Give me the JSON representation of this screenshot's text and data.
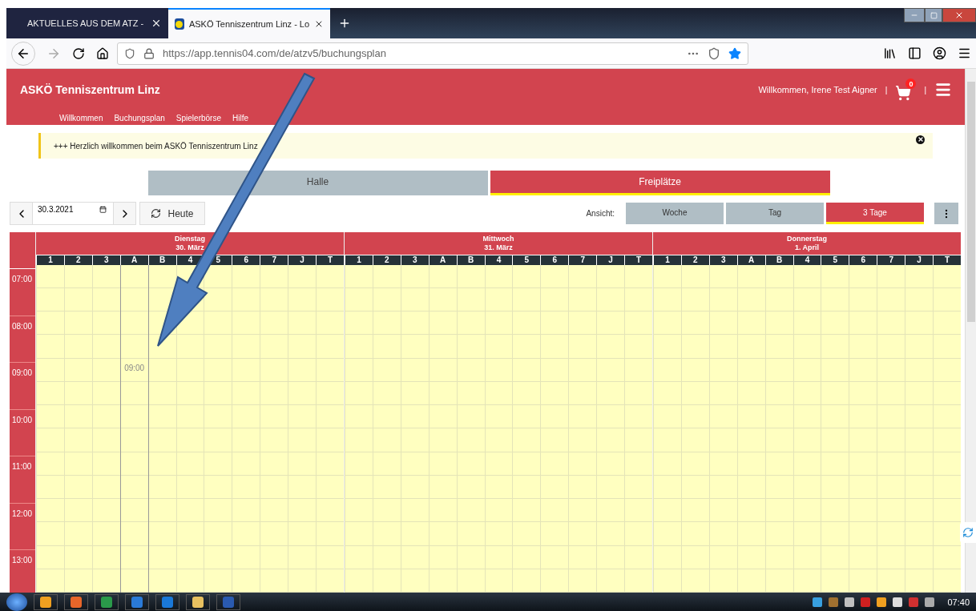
{
  "browser": {
    "tabs": [
      {
        "title": "AKTUELLES AUS DEM ATZ -",
        "selected": false
      },
      {
        "title": "ASKÖ Tenniszentrum Linz - Lo",
        "selected": true
      }
    ],
    "url": "https://app.tennis04.com/de/atzv5/buchungsplan"
  },
  "header": {
    "title": "ASKÖ Tenniszentrum Linz",
    "nav": [
      "Willkommen",
      "Buchungsplan",
      "Spielerbörse",
      "Hilfe"
    ],
    "user": "Willkommen, Irene Test Aigner",
    "separator": "|",
    "cart_count": "0"
  },
  "banner": {
    "text": "+++ Herzlich willkommen beim ASKÖ Tenniszentrum Linz"
  },
  "locations": [
    {
      "label": "Halle",
      "selected": false
    },
    {
      "label": "Freiplätze",
      "selected": true
    }
  ],
  "date_field": {
    "value": "30.3.2021"
  },
  "today_button": "Heute",
  "view": {
    "label": "Ansicht:",
    "options": [
      {
        "label": "Woche",
        "selected": false
      },
      {
        "label": "Tag",
        "selected": false
      },
      {
        "label": "3 Tage",
        "selected": true
      }
    ]
  },
  "days": [
    {
      "name": "Dienstag",
      "date": "30. März",
      "courts": [
        "1",
        "2",
        "3",
        "A",
        "B",
        "4",
        "5",
        "6",
        "7",
        "J",
        "T"
      ]
    },
    {
      "name": "Mittwoch",
      "date": "31. März",
      "courts": [
        "1",
        "2",
        "3",
        "A",
        "B",
        "4",
        "5",
        "6",
        "7",
        "J",
        "T"
      ]
    },
    {
      "name": "Donnerstag",
      "date": "1. April",
      "courts": [
        "1",
        "2",
        "3",
        "A",
        "B",
        "4",
        "5",
        "6",
        "7",
        "J",
        "T"
      ]
    }
  ],
  "hours": [
    "07:00",
    "08:00",
    "09:00",
    "10:00",
    "11:00",
    "12:00",
    "13:00"
  ],
  "hover_slot": {
    "text": "09:00"
  },
  "taskbar": {
    "clock": "07:40"
  }
}
